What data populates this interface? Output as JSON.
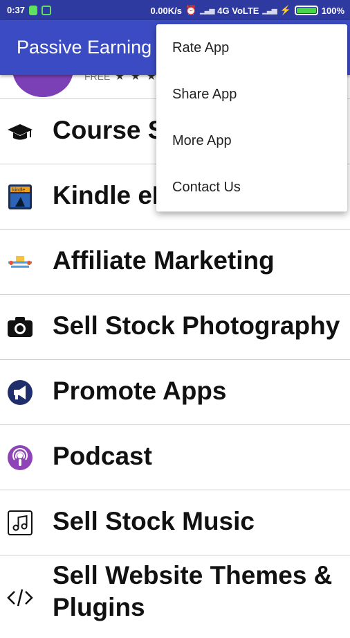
{
  "status_bar": {
    "time": "0:37",
    "speed": "0.00K/s",
    "network": "4G VoLTE",
    "battery": "100%"
  },
  "app_bar": {
    "title": "Passive Earning"
  },
  "header": {
    "free_label": "FREE",
    "stars": "★ ★ ★"
  },
  "items": [
    {
      "label": "Course S",
      "icon": "graduation-cap-icon"
    },
    {
      "label": "Kindle eB",
      "icon": "kindle-icon"
    },
    {
      "label": "Affiliate Marketing",
      "icon": "affiliate-icon"
    },
    {
      "label": "Sell Stock Photography",
      "icon": "camera-icon"
    },
    {
      "label": "Promote Apps",
      "icon": "megaphone-icon"
    },
    {
      "label": "Podcast",
      "icon": "podcast-icon"
    },
    {
      "label": "Sell Stock Music",
      "icon": "music-note-icon"
    },
    {
      "label": "Sell Website Themes & Plugins",
      "icon": "code-icon"
    }
  ],
  "menu": {
    "items": [
      "Rate App",
      "Share App",
      "More App",
      "Contact Us"
    ]
  }
}
